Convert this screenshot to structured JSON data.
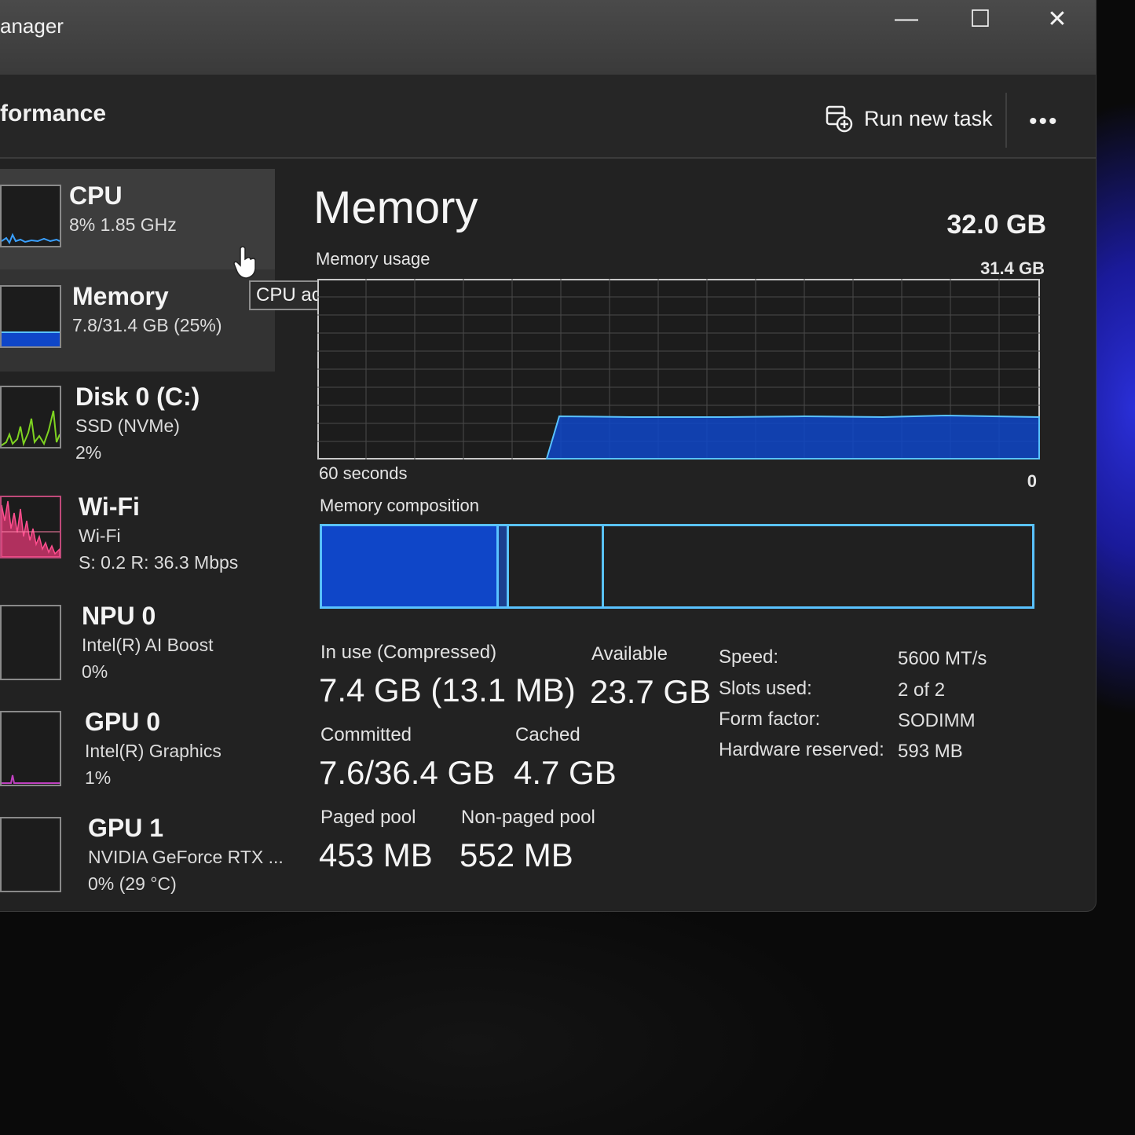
{
  "window": {
    "title": "anager",
    "page": "formance",
    "run_task_label": "Run new task",
    "more_label": "•••",
    "minimize_glyph": "—",
    "maximize_glyph": "☐",
    "close_glyph": "✕"
  },
  "sidebar": {
    "items": [
      {
        "name": "CPU",
        "line1": "8%  1.85 GHz",
        "line2": "",
        "color": "#3aa0ff"
      },
      {
        "name": "Memory",
        "line1": "7.8/31.4 GB (25%)",
        "line2": "",
        "color": "#1f6fff"
      },
      {
        "name": "Disk 0 (C:)",
        "line1": "SSD (NVMe)",
        "line2": "2%",
        "color": "#7ed321"
      },
      {
        "name": "Wi-Fi",
        "line1": "Wi-Fi",
        "line2": "S: 0.2  R: 36.3 Mbps",
        "color": "#e0407a"
      },
      {
        "name": "NPU 0",
        "line1": "Intel(R) AI Boost",
        "line2": "0%",
        "color": "#3aa0ff"
      },
      {
        "name": "GPU 0",
        "line1": "Intel(R) Graphics",
        "line2": "1%",
        "color": "#c040c0"
      },
      {
        "name": "GPU 1",
        "line1": "NVIDIA GeForce RTX ...",
        "line2": "0%  (29 °C)",
        "color": "#c040c0"
      }
    ],
    "tooltip": "CPU activity"
  },
  "memory": {
    "title": "Memory",
    "total": "32.0 GB",
    "usage_label": "Memory usage",
    "usage_max": "31.4 GB",
    "time_label": "60 seconds",
    "min_label": "0",
    "composition_label": "Memory composition",
    "stats": {
      "in_use_label": "In use (Compressed)",
      "in_use_value": "7.4 GB (13.1 MB)",
      "available_label": "Available",
      "available_value": "23.7 GB",
      "committed_label": "Committed",
      "committed_value": "7.6/36.4 GB",
      "cached_label": "Cached",
      "cached_value": "4.7 GB",
      "paged_label": "Paged pool",
      "paged_value": "453 MB",
      "nonpaged_label": "Non-paged pool",
      "nonpaged_value": "552 MB"
    },
    "details": {
      "speed_label": "Speed:",
      "speed_value": "5600 MT/s",
      "slots_label": "Slots used:",
      "slots_value": "2 of 2",
      "form_label": "Form factor:",
      "form_value": "SODIMM",
      "reserved_label": "Hardware reserved:",
      "reserved_value": "593 MB"
    },
    "accent_color": "#0f46c8",
    "outline_color": "#59c2ff"
  }
}
